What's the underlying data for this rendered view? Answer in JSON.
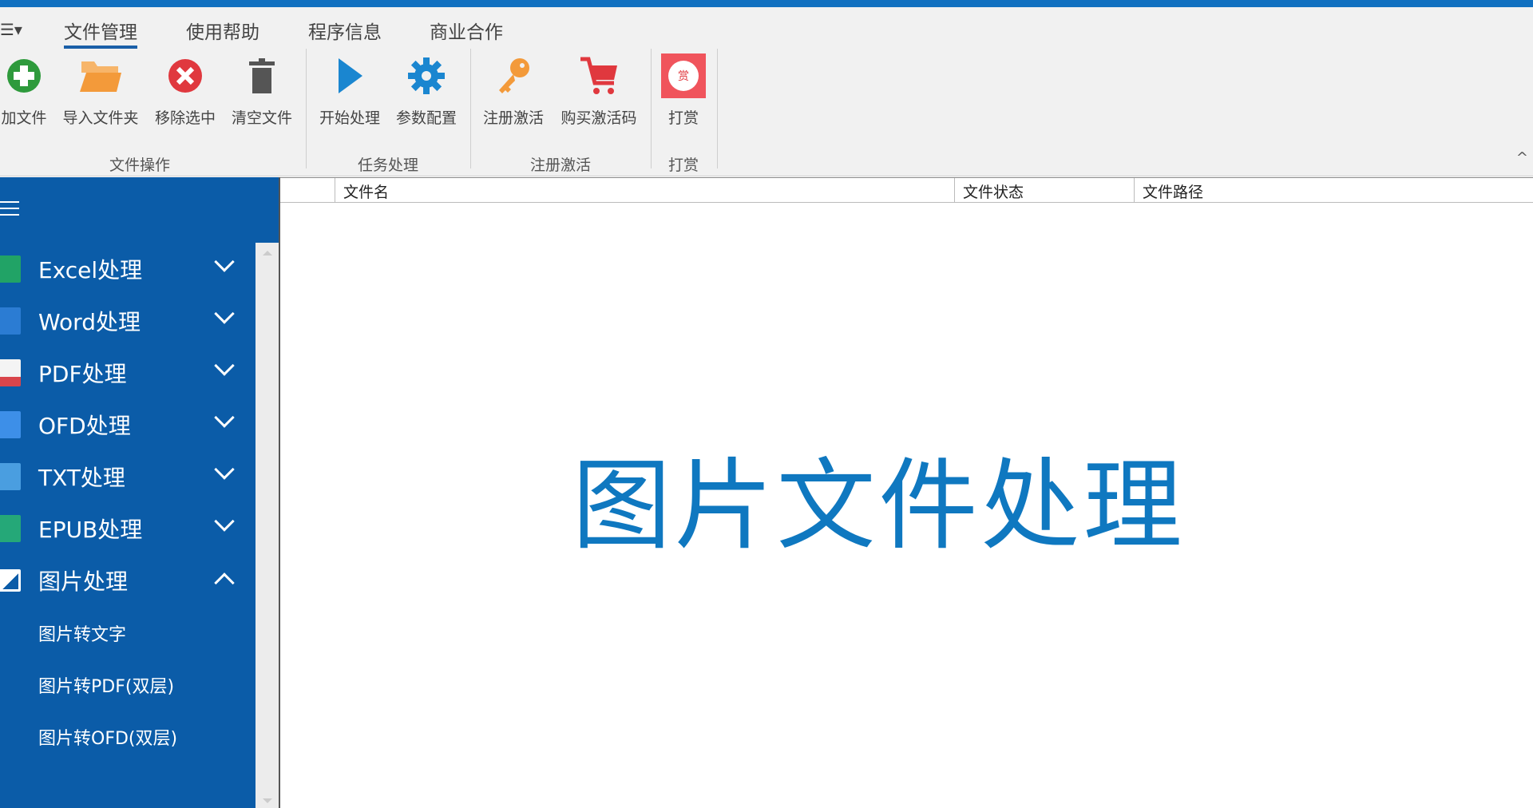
{
  "tabs": [
    "文件管理",
    "使用帮助",
    "程序信息",
    "商业合作"
  ],
  "ribbon": {
    "buttons": [
      "加文件",
      "导入文件夹",
      "移除选中",
      "清空文件",
      "开始处理",
      "参数配置",
      "注册激活",
      "购买激活码",
      "打赏"
    ],
    "groups": [
      "文件操作",
      "任务处理",
      "注册激活",
      "打赏"
    ],
    "reward_badge": "赏"
  },
  "sidebar": {
    "items": [
      "Excel处理",
      "Word处理",
      "PDF处理",
      "OFD处理",
      "TXT处理",
      "EPUB处理",
      "图片处理"
    ],
    "subitems": [
      "图片转文字",
      "图片转PDF(双层)",
      "图片转OFD(双层)"
    ]
  },
  "table": {
    "columns": [
      "",
      "文件名",
      "文件状态",
      "文件路径"
    ]
  },
  "main": {
    "title": "图片文件处理"
  },
  "colors": {
    "accent": "#0b5ca8",
    "title": "#0f78c0"
  }
}
